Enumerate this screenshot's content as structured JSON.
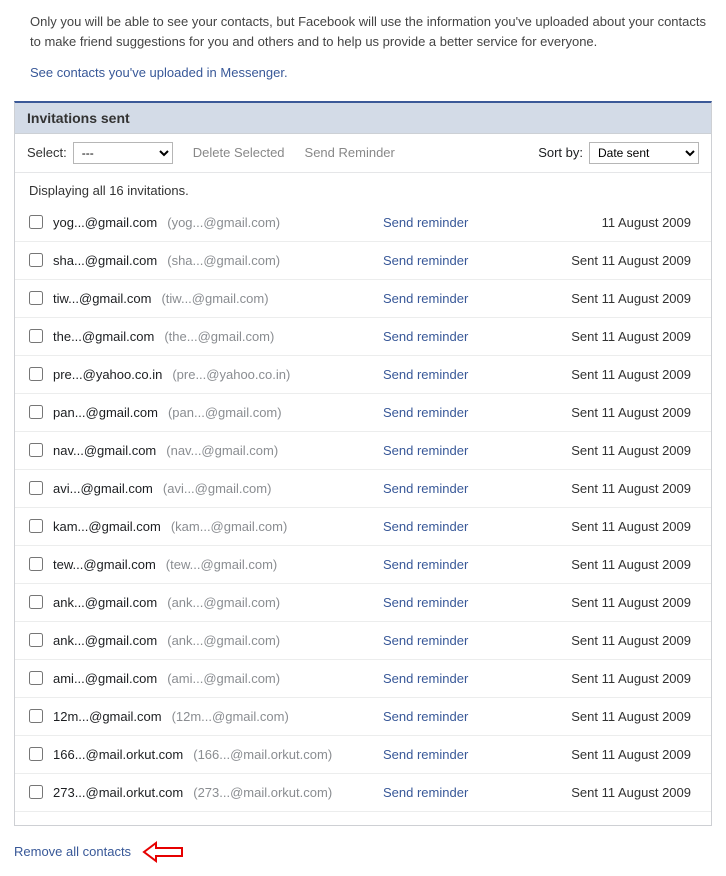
{
  "intro": "Only you will be able to see your contacts, but Facebook will use the information you've uploaded about your contacts to make friend suggestions for you and others and to help us provide a better service for everyone.",
  "messenger_link": "See contacts you've uploaded in Messenger.",
  "panel_title": "Invitations sent",
  "toolbar": {
    "select_label": "Select:",
    "select_placeholder": "---",
    "delete_label": "Delete Selected",
    "send_reminder_label": "Send Reminder",
    "sort_label": "Sort by:",
    "sort_value": "Date sent"
  },
  "display_summary": "Displaying all 16 invitations.",
  "action_label": "Send reminder",
  "rows": [
    {
      "primary": "yog...@gmail.com",
      "secondary": "(yog...@gmail.com)",
      "date": "11 August 2009"
    },
    {
      "primary": "sha...@gmail.com",
      "secondary": "(sha...@gmail.com)",
      "date": "Sent 11 August 2009"
    },
    {
      "primary": "tiw...@gmail.com",
      "secondary": "(tiw...@gmail.com)",
      "date": "Sent 11 August 2009"
    },
    {
      "primary": "the...@gmail.com",
      "secondary": "(the...@gmail.com)",
      "date": "Sent 11 August 2009"
    },
    {
      "primary": "pre...@yahoo.co.in",
      "secondary": "(pre...@yahoo.co.in)",
      "date": "Sent 11 August 2009"
    },
    {
      "primary": "pan...@gmail.com",
      "secondary": "(pan...@gmail.com)",
      "date": "Sent 11 August 2009"
    },
    {
      "primary": "nav...@gmail.com",
      "secondary": "(nav...@gmail.com)",
      "date": "Sent 11 August 2009"
    },
    {
      "primary": "avi...@gmail.com",
      "secondary": "(avi...@gmail.com)",
      "date": "Sent 11 August 2009"
    },
    {
      "primary": "kam...@gmail.com",
      "secondary": "(kam...@gmail.com)",
      "date": "Sent 11 August 2009"
    },
    {
      "primary": "tew...@gmail.com",
      "secondary": "(tew...@gmail.com)",
      "date": "Sent 11 August 2009"
    },
    {
      "primary": "ank...@gmail.com",
      "secondary": "(ank...@gmail.com)",
      "date": "Sent 11 August 2009"
    },
    {
      "primary": "ank...@gmail.com",
      "secondary": "(ank...@gmail.com)",
      "date": "Sent 11 August 2009"
    },
    {
      "primary": "ami...@gmail.com",
      "secondary": "(ami...@gmail.com)",
      "date": "Sent 11 August 2009"
    },
    {
      "primary": "12m...@gmail.com",
      "secondary": "(12m...@gmail.com)",
      "date": "Sent 11 August 2009"
    },
    {
      "primary": "166...@mail.orkut.com",
      "secondary": "(166...@mail.orkut.com)",
      "date": "Sent 11 August 2009"
    },
    {
      "primary": "273...@mail.orkut.com",
      "secondary": "(273...@mail.orkut.com)",
      "date": "Sent 11 August 2009"
    }
  ],
  "remove_all_label": "Remove all contacts"
}
